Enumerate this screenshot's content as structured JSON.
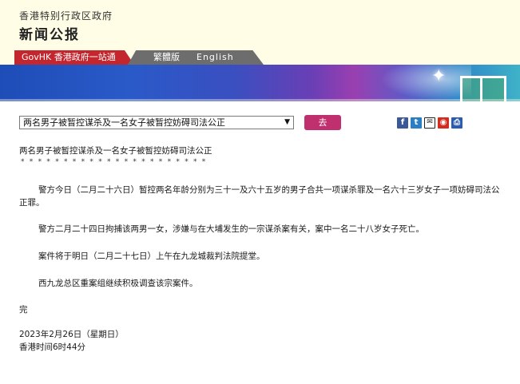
{
  "header": {
    "gov_name": "香港特别行政区政府",
    "press_title": "新闻公报"
  },
  "nav": {
    "govhk_label": "GovHK 香港政府一站通",
    "traditional_label": "繁體版",
    "english_label": "English"
  },
  "toolbar": {
    "select_value": "两名男子被暂控谋杀及一名女子被暂控妨碍司法公正",
    "go_label": "去",
    "share_icons": [
      "facebook-icon",
      "twitter-icon",
      "email-icon",
      "weibo-icon",
      "print-icon"
    ]
  },
  "article": {
    "title": "两名男子被暂控谋杀及一名女子被暂控妨碍司法公正",
    "separator": "**********************",
    "paragraphs": [
      "警方今日（二月二十六日）暂控两名年龄分别为三十一及六十五岁的男子合共一项谋杀罪及一名六十三岁女子一项妨碍司法公正罪。",
      "警方二月二十四日拘捕该两男一女，涉嫌与在大埔发生的一宗谋杀案有关，案中一名二十八岁女子死亡。",
      "案件将于明日（二月二十七日）上午在九龙城裁判法院提堂。",
      "西九龙总区重案组继续积极调查该宗案件。"
    ],
    "ending": "完",
    "date": "2023年2月26日（星期日）",
    "time": "香港时间6时44分"
  },
  "colors": {
    "header_bg": "#fffde6",
    "govhk_red": "#c4262e",
    "lang_gray": "#6d6d6d",
    "go_button": "#c0306f"
  }
}
